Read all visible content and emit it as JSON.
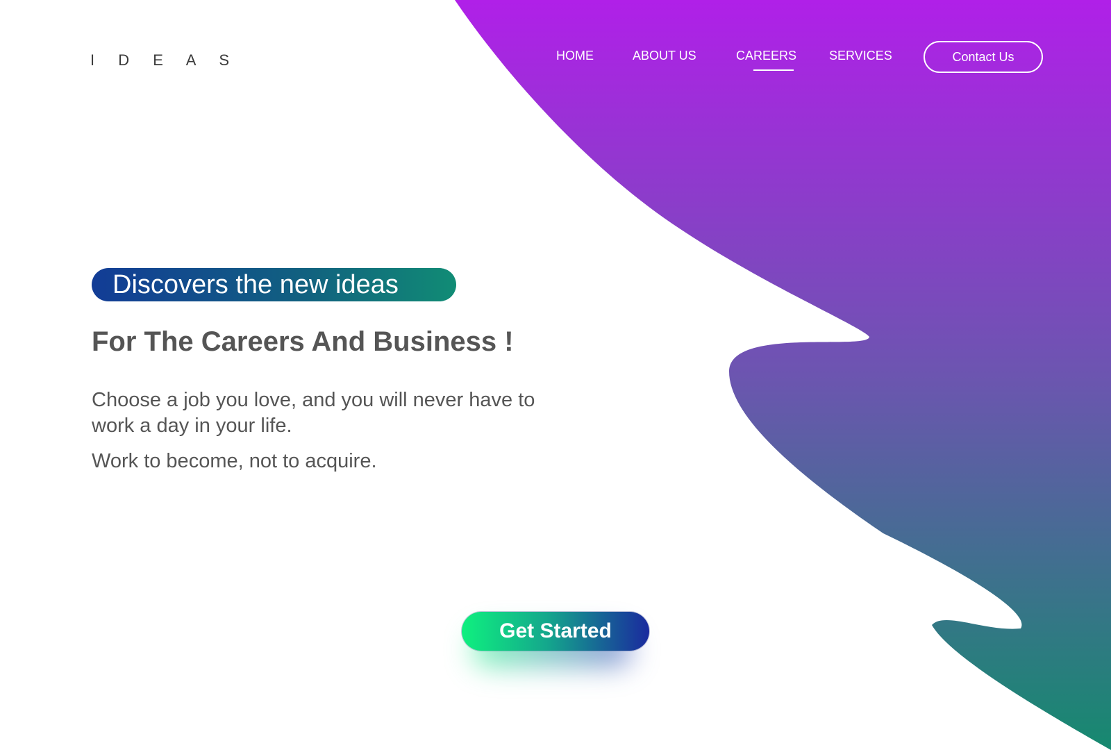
{
  "header": {
    "logo": "I D E A S",
    "nav": {
      "items": [
        {
          "label": "HOME"
        },
        {
          "label": "ABOUT US"
        },
        {
          "label": "CAREERS",
          "active": true
        },
        {
          "label": "SERVICES"
        }
      ],
      "contact_label": "Contact Us"
    }
  },
  "hero": {
    "pill_text": "Discovers the new  ideas",
    "headline": "For The Careers And Business !",
    "quote_1": "Choose a job you love, and you will never have to work a day in your life.",
    "quote_2": "Work to become, not to acquire.",
    "cta_label": "Get Started"
  },
  "colors": {
    "blob_top": "#b020e8",
    "blob_bottom": "#16896f",
    "pill_start": "#123c96",
    "pill_end": "#118c75",
    "cta_start": "#0ff07f",
    "cta_end": "#1a2a9e",
    "text_gray": "#555555"
  }
}
